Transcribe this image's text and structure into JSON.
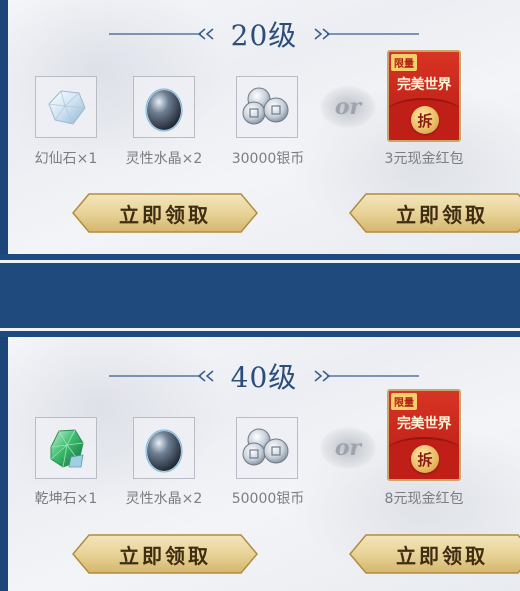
{
  "tiers": [
    {
      "level": "20级",
      "rewards": [
        {
          "label": "幻仙石×1",
          "icon": "clear-crystal-gem-icon"
        },
        {
          "label": "灵性水晶×2",
          "icon": "dark-crystal-egg-icon"
        },
        {
          "label": "30000银币",
          "icon": "silver-coins-icon"
        }
      ],
      "or_label": "or",
      "redpack": {
        "tag": "限量",
        "brand": "完美世界",
        "open": "拆",
        "label": "3元现金红包"
      },
      "claim_left": "立即领取",
      "claim_right": "立即领取"
    },
    {
      "level": "40级",
      "rewards": [
        {
          "label": "乾坤石×1",
          "icon": "green-crystal-gem-icon"
        },
        {
          "label": "灵性水晶×2",
          "icon": "dark-crystal-egg-icon"
        },
        {
          "label": "50000银币",
          "icon": "silver-coins-icon"
        }
      ],
      "or_label": "or",
      "redpack": {
        "tag": "限量",
        "brand": "完美世界",
        "open": "拆",
        "label": "8元现金红包"
      },
      "claim_left": "立即领取",
      "claim_right": "立即领取"
    }
  ],
  "colors": {
    "band": "#1f4a7e",
    "title": "#2a4d7c",
    "button_gold": "#e9d49b",
    "redpack": "#c8231a"
  }
}
